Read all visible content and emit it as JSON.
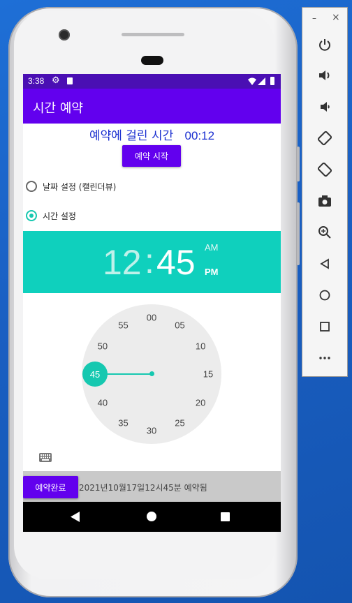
{
  "status_bar": {
    "time": "3:38"
  },
  "app": {
    "title": "시간 예약"
  },
  "reservation": {
    "label": "예약에 걸린 시간",
    "elapsed": "00:12",
    "start_button": "예약 시작"
  },
  "options": [
    {
      "label": "날짜 설정 (캘린더뷰)",
      "selected": false
    },
    {
      "label": "시간 설정",
      "selected": true
    }
  ],
  "time_picker": {
    "hour": "12",
    "separator": ":",
    "minute": "45",
    "am": "AM",
    "pm": "PM",
    "selected_minute": "45",
    "minute_labels": [
      "00",
      "05",
      "10",
      "15",
      "20",
      "25",
      "30",
      "35",
      "40",
      "45",
      "50",
      "55"
    ]
  },
  "bottom": {
    "done_button": "예약완료",
    "status_text": "2021년10월17일12시45분 예약됨"
  },
  "panel": {
    "minimize": "–",
    "close": "×"
  },
  "colors": {
    "accent": "#6200ee",
    "teal": "#0fd0bd",
    "status_bar": "#4a0fb3",
    "link_blue": "#1a2fd0"
  }
}
